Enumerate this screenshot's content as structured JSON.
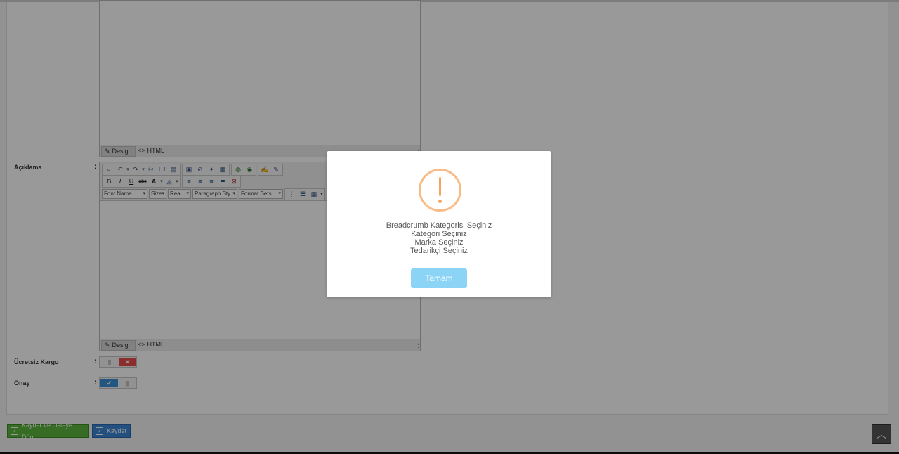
{
  "editor": {
    "mode_design": "Design",
    "mode_html": "HTML",
    "toolbar": {
      "font_name": "Font Name",
      "size": "Size",
      "real": "Real ...",
      "paragraph_style": "Paragraph Sty...",
      "format_sets": "Format Sets"
    }
  },
  "form": {
    "aciklama_label": "Açıklama",
    "ucretsiz_kargo_label": "Ücretsiz Kargo",
    "onay_label": "Onay",
    "colon": ":"
  },
  "toggles": {
    "ucretsiz_kargo": "off",
    "onay": "on"
  },
  "actions": {
    "save_and_return": "Kaydet Ve Listeye Dön",
    "save": "Kaydet"
  },
  "modal": {
    "messages": [
      "Breadcrumb Kategorisi Seçiniz",
      "Kategori Seçiniz",
      "Marka Seçiniz",
      "Tedarikçi Seçiniz"
    ],
    "confirm_label": "Tamam",
    "icon": "warning-icon",
    "colors": {
      "icon_border": "#f8bb86",
      "confirm_bg": "#8cd4f5"
    }
  },
  "colors": {
    "save_and_return_bg": "#5cb53c",
    "save_bg": "#3c86d4"
  }
}
